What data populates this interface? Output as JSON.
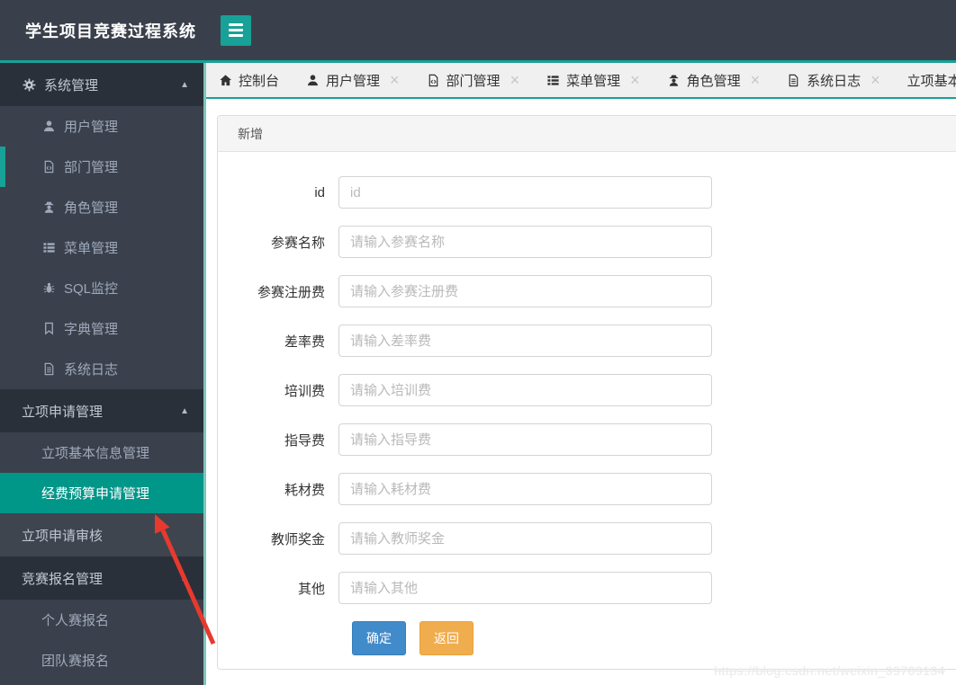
{
  "app": {
    "title": "学生项目竞赛过程系统"
  },
  "colors": {
    "accent_teal": "#18a197",
    "selected_item_teal": "#009688",
    "primary_button_blue": "#428bca",
    "back_button_orange": "#f0ad4e",
    "annotation_arrow_red": "#e8392f"
  },
  "glyphs": {
    "caret_up": "▲",
    "close": "×"
  },
  "sidebar": {
    "items": [
      {
        "label": "系统管理",
        "icon": "gear-icon",
        "type": "header",
        "expanded": true
      },
      {
        "label": "用户管理",
        "icon": "user-icon",
        "type": "sub"
      },
      {
        "label": "部门管理",
        "icon": "file-code-icon",
        "type": "sub",
        "active_marker": true
      },
      {
        "label": "角色管理",
        "icon": "role-icon",
        "type": "sub"
      },
      {
        "label": "菜单管理",
        "icon": "list-icon",
        "type": "sub"
      },
      {
        "label": "SQL监控",
        "icon": "bug-icon",
        "type": "sub"
      },
      {
        "label": "字典管理",
        "icon": "bookmark-icon",
        "type": "sub"
      },
      {
        "label": "系统日志",
        "icon": "file-text-icon",
        "type": "sub"
      },
      {
        "label": "立项申请管理",
        "type": "header",
        "expanded": true
      },
      {
        "label": "立项基本信息管理",
        "type": "sub"
      },
      {
        "label": "经费预算申请管理",
        "type": "sub",
        "selected": true
      },
      {
        "label": "立项申请审核",
        "type": "plain"
      },
      {
        "label": "竞赛报名管理",
        "type": "header",
        "expanded": true
      },
      {
        "label": "个人赛报名",
        "type": "sub"
      },
      {
        "label": "团队赛报名",
        "type": "sub"
      }
    ]
  },
  "tabs": [
    {
      "label": "控制台",
      "icon": "home-icon",
      "closable": false
    },
    {
      "label": "用户管理",
      "icon": "user-icon",
      "closable": true
    },
    {
      "label": "部门管理",
      "icon": "file-code-icon",
      "closable": true
    },
    {
      "label": "菜单管理",
      "icon": "list-icon",
      "closable": true
    },
    {
      "label": "角色管理",
      "icon": "role-icon",
      "closable": true
    },
    {
      "label": "系统日志",
      "icon": "file-text-icon",
      "closable": true
    },
    {
      "label": "立项基本信息管理",
      "icon": "",
      "closable": false
    }
  ],
  "panel": {
    "title": "新增",
    "fields": [
      {
        "label": "id",
        "placeholder": "id",
        "value": ""
      },
      {
        "label": "参赛名称",
        "placeholder": "请输入参赛名称",
        "value": ""
      },
      {
        "label": "参赛注册费",
        "placeholder": "请输入参赛注册费",
        "value": ""
      },
      {
        "label": "差率费",
        "placeholder": "请输入差率费",
        "value": ""
      },
      {
        "label": "培训费",
        "placeholder": "请输入培训费",
        "value": ""
      },
      {
        "label": "指导费",
        "placeholder": "请输入指导费",
        "value": ""
      },
      {
        "label": "耗材费",
        "placeholder": "请输入耗材费",
        "value": ""
      },
      {
        "label": "教师奖金",
        "placeholder": "请输入教师奖金",
        "value": ""
      },
      {
        "label": "其他",
        "placeholder": "请输入其他",
        "value": ""
      }
    ],
    "buttons": {
      "confirm": "确定",
      "back": "返回"
    }
  },
  "watermark": "https://blog.csdn.net/weixin_39709134"
}
